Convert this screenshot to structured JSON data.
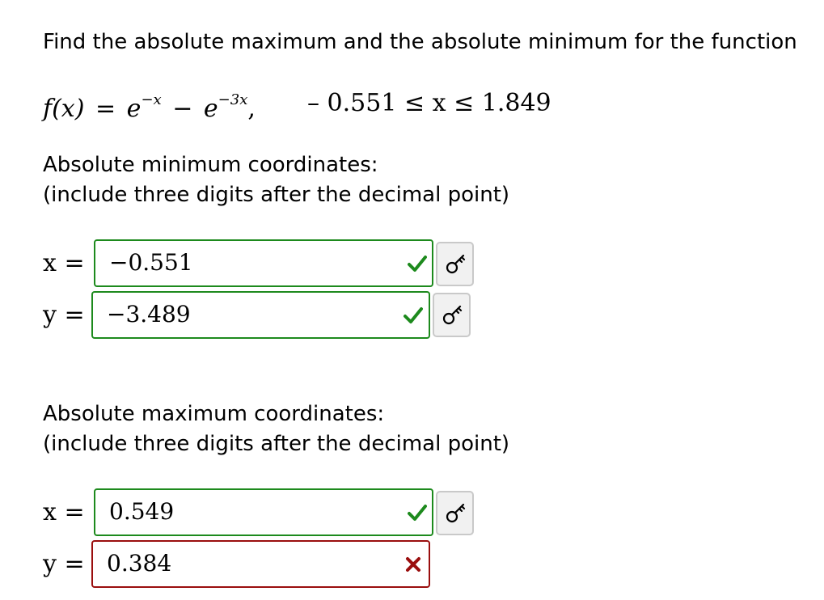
{
  "prompt": "Find the absolute maximum and the absolute minimum for the function",
  "function": {
    "lhs": "f(x)",
    "eq": "=",
    "base1": "e",
    "exp1": "−x",
    "minus": "−",
    "base2": "e",
    "exp2": "−3x",
    "comma": ",",
    "domain": "– 0.551 ≤ x ≤ 1.849"
  },
  "minimum": {
    "heading": "Absolute minimum coordinates:",
    "instruction": "(include three digits after the decimal point)",
    "x_label": "x =",
    "y_label": "y =",
    "x_value": "−0.551",
    "y_value": "−3.489",
    "x_status": "correct",
    "y_status": "correct"
  },
  "maximum": {
    "heading": "Absolute maximum coordinates:",
    "instruction": "(include three digits after the decimal point)",
    "x_label": "x =",
    "y_label": "y =",
    "x_value": "0.549",
    "y_value": "0.384",
    "x_status": "correct",
    "y_status": "incorrect"
  },
  "colors": {
    "correct": "#1d8a1d",
    "incorrect": "#9a0e0e",
    "key_button_bg": "#f1f1f1"
  },
  "icons": {
    "correct": "check-icon",
    "incorrect": "cross-icon",
    "answer_key": "key-icon"
  }
}
